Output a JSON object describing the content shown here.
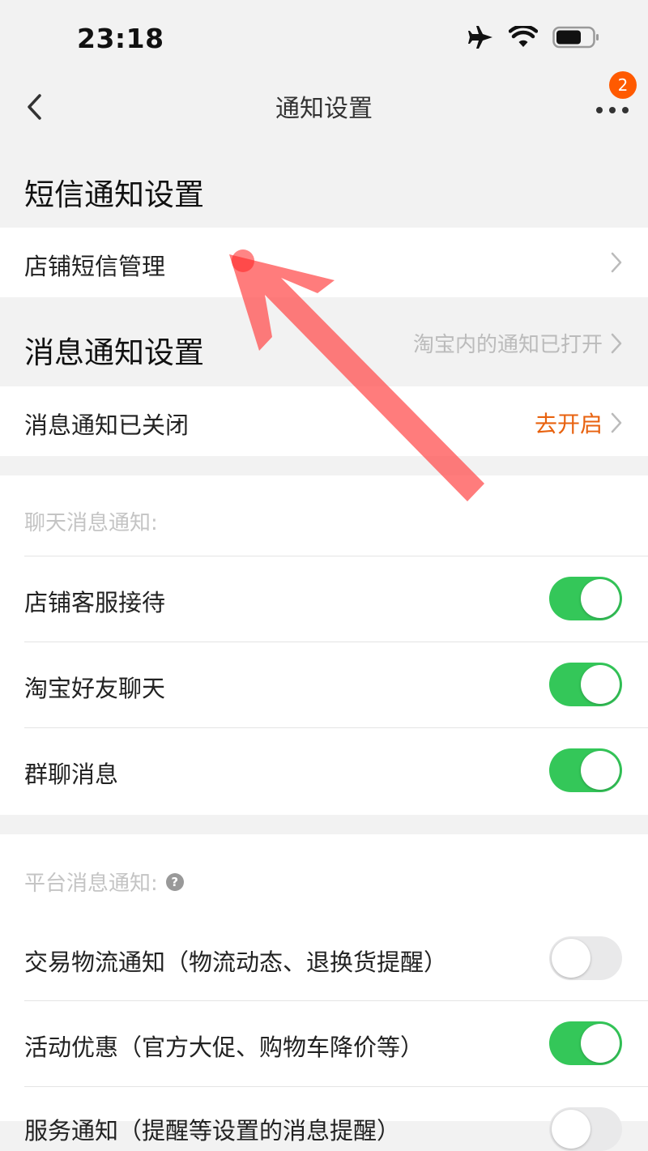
{
  "status_bar": {
    "time": "23:18",
    "icons": [
      "airplane-icon",
      "wifi-icon",
      "battery-icon"
    ]
  },
  "nav": {
    "title": "通知设置",
    "badge_count": "2"
  },
  "sms_section": {
    "title": "短信通知设置"
  },
  "sms_manage": {
    "label": "店铺短信管理"
  },
  "msg_section": {
    "title": "消息通知设置",
    "hint": "淘宝内的通知已打开"
  },
  "msg_status": {
    "label": "消息通知已关闭",
    "action": "去开启"
  },
  "chat": {
    "heading": "聊天消息通知:",
    "items": [
      {
        "label": "店铺客服接待",
        "enabled": true
      },
      {
        "label": "淘宝好友聊天",
        "enabled": true
      },
      {
        "label": "群聊消息",
        "enabled": true
      }
    ]
  },
  "platform": {
    "heading": "平台消息通知:",
    "help": "?",
    "items": [
      {
        "label": "交易物流通知（物流动态、退换货提醒）",
        "enabled": false
      },
      {
        "label": "活动优惠（官方大促、购物车降价等）",
        "enabled": true
      },
      {
        "label": "服务通知（提醒等设置的消息提醒）",
        "enabled": false
      }
    ]
  },
  "colors": {
    "toggle_on": "#34c759",
    "toggle_off": "#e9e9ea",
    "accent": "#e8620f",
    "badge": "#ff5a00",
    "annotation_arrow": "#ff3b3b"
  }
}
